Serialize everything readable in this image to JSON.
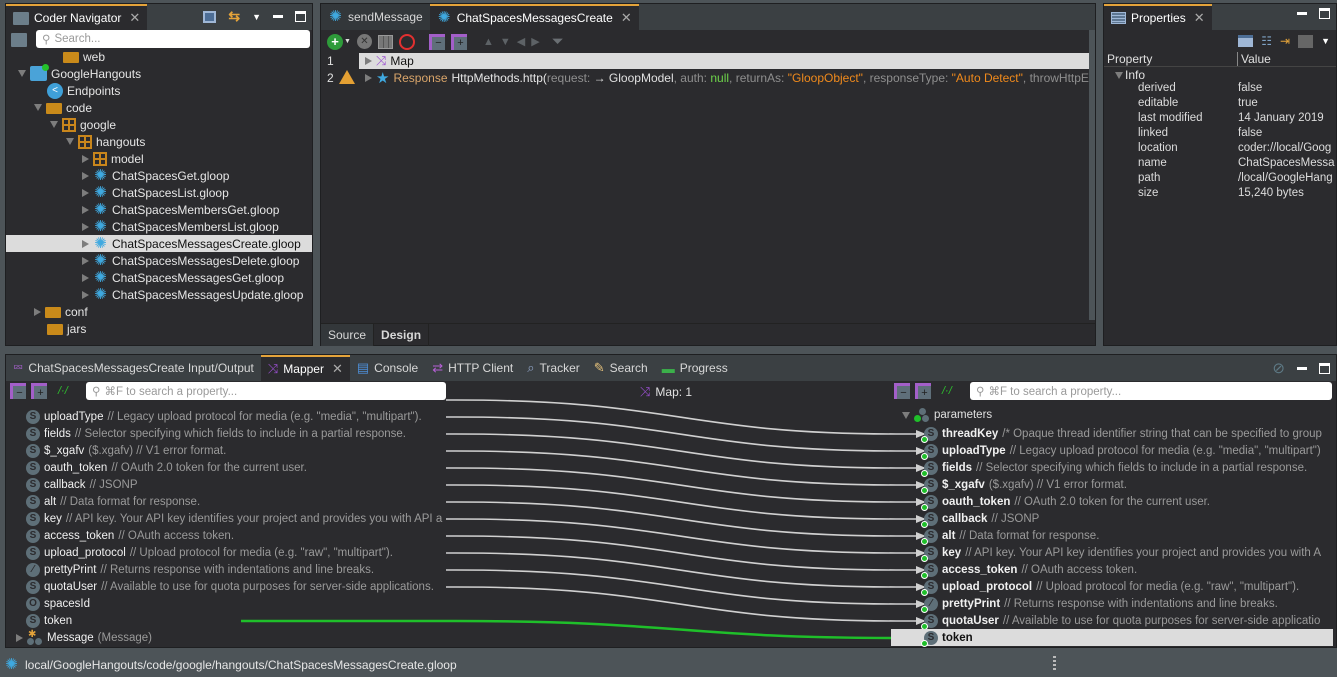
{
  "navigator": {
    "tab_label": "Coder Navigator",
    "search_placeholder": "Search...",
    "tree": [
      {
        "label": "web",
        "icon": "folder-icon",
        "expander": "none",
        "indent": 3
      },
      {
        "label": "GoogleHangouts",
        "icon": "package-cube-icon",
        "expander": "expanded",
        "indent": 1
      },
      {
        "label": "Endpoints",
        "icon": "share-icon",
        "expander": "none",
        "indent": 2
      },
      {
        "label": "code",
        "icon": "folder-icon",
        "expander": "expanded",
        "indent": 2
      },
      {
        "label": "google",
        "icon": "package-icon",
        "expander": "expanded",
        "indent": 3
      },
      {
        "label": "hangouts",
        "icon": "package-icon",
        "expander": "expanded",
        "indent": 4
      },
      {
        "label": "model",
        "icon": "package-icon",
        "expander": "collapsed",
        "indent": 5
      },
      {
        "label": "ChatSpacesGet.gloop",
        "icon": "gloop-icon",
        "expander": "collapsed",
        "indent": 5
      },
      {
        "label": "ChatSpacesList.gloop",
        "icon": "gloop-icon",
        "expander": "collapsed",
        "indent": 5
      },
      {
        "label": "ChatSpacesMembersGet.gloop",
        "icon": "gloop-icon",
        "expander": "collapsed",
        "indent": 5
      },
      {
        "label": "ChatSpacesMembersList.gloop",
        "icon": "gloop-icon",
        "expander": "collapsed",
        "indent": 5
      },
      {
        "label": "ChatSpacesMessagesCreate.gloop",
        "icon": "gloop-icon",
        "expander": "collapsed",
        "indent": 5,
        "selected": true
      },
      {
        "label": "ChatSpacesMessagesDelete.gloop",
        "icon": "gloop-icon",
        "expander": "collapsed",
        "indent": 5
      },
      {
        "label": "ChatSpacesMessagesGet.gloop",
        "icon": "gloop-icon",
        "expander": "collapsed",
        "indent": 5
      },
      {
        "label": "ChatSpacesMessagesUpdate.gloop",
        "icon": "gloop-icon",
        "expander": "collapsed",
        "indent": 5
      },
      {
        "label": "conf",
        "icon": "folder-icon",
        "expander": "collapsed",
        "indent": 2
      },
      {
        "label": "jars",
        "icon": "folder-icon",
        "expander": "none",
        "indent": 2
      }
    ]
  },
  "editor": {
    "tabs": [
      {
        "label": "sendMessage",
        "active": false
      },
      {
        "label": "ChatSpacesMessagesCreate",
        "active": true
      }
    ],
    "lines": [
      {
        "num": "1",
        "label": "Map"
      },
      {
        "num": "2",
        "prefix": "Response",
        "call": "HttpMethods.http(",
        "args": [
          {
            "k": " request: ",
            "v": "→ GloopModel",
            "c": "#e0e0e0"
          },
          {
            "k": ", auth: ",
            "v": "null",
            "c": "#6dd34a"
          },
          {
            "k": ", returnAs: ",
            "v": "\"GloopObject\"",
            "c": "#f08a1c"
          },
          {
            "k": ", responseType: ",
            "v": "\"Auto Detect\"",
            "c": "#f08a1c"
          },
          {
            "k": ", throwHttpExc",
            "v": "",
            "c": "#e0e0e0"
          }
        ]
      }
    ],
    "bottom_tabs": [
      "Source",
      "Design"
    ],
    "active_bottom_tab": "Design"
  },
  "properties": {
    "tab_label": "Properties",
    "col_property": "Property",
    "col_value": "Value",
    "group": "Info",
    "rows": [
      {
        "k": "derived",
        "v": "false"
      },
      {
        "k": "editable",
        "v": "true"
      },
      {
        "k": "last modified",
        "v": "14 January 2019"
      },
      {
        "k": "linked",
        "v": "false"
      },
      {
        "k": "location",
        "v": "coder://local/Goog"
      },
      {
        "k": "name",
        "v": "ChatSpacesMessa"
      },
      {
        "k": "path",
        "v": "/local/GoogleHang"
      },
      {
        "k": "size",
        "v": "15,240  bytes"
      }
    ]
  },
  "bottom": {
    "tabs": [
      {
        "label": "ChatSpacesMessagesCreate Input/Output",
        "icon": "input-output-icon"
      },
      {
        "label": "Mapper",
        "icon": "shuffle-icon",
        "active": true
      },
      {
        "label": "Console",
        "icon": "console-icon"
      },
      {
        "label": "HTTP Client",
        "icon": "http-arrows-icon"
      },
      {
        "label": "Tracker",
        "icon": "tracker-icon"
      },
      {
        "label": "Search",
        "icon": "search-flashlight-icon"
      },
      {
        "label": "Progress",
        "icon": "progress-icon"
      }
    ],
    "search_placeholder": "⌘F to search a property...",
    "map_label": "Map: 1",
    "left_fields": [
      {
        "name": "uploadType",
        "comment": "// Legacy upload protocol for media (e.g. \"media\", \"multipart\").",
        "type": "S"
      },
      {
        "name": "fields",
        "comment": "// Selector specifying which fields to include in a partial response.",
        "type": "S"
      },
      {
        "name": "$_xgafv",
        "comment": "($.xgafv) // V1 error format.",
        "type": "S"
      },
      {
        "name": "oauth_token",
        "comment": "// OAuth 2.0 token for the current user.",
        "type": "S"
      },
      {
        "name": "callback",
        "comment": "// JSONP",
        "type": "S"
      },
      {
        "name": "alt",
        "comment": "// Data format for response.",
        "type": "S"
      },
      {
        "name": "key",
        "comment": "// API key. Your API key identifies your project and provides you with API a",
        "type": "S"
      },
      {
        "name": "access_token",
        "comment": "// OAuth access token.",
        "type": "S"
      },
      {
        "name": "upload_protocol",
        "comment": "// Upload protocol for media (e.g. \"raw\", \"multipart\").",
        "type": "S"
      },
      {
        "name": "prettyPrint",
        "comment": "// Returns response with indentations and line breaks.",
        "type": "T/F"
      },
      {
        "name": "quotaUser",
        "comment": "// Available to use for quota purposes for server-side applications.",
        "type": "S"
      },
      {
        "name": "spacesId",
        "comment": "",
        "type": "O"
      },
      {
        "name": "token",
        "comment": "",
        "type": "S"
      }
    ],
    "left_message": {
      "name": "Message",
      "comment": "(Message)"
    },
    "right_group": "parameters",
    "right_fields": [
      {
        "name": "threadKey",
        "comment": "/* Opaque thread identifier string that can be specified to group",
        "type": "S"
      },
      {
        "name": "uploadType",
        "comment": "// Legacy upload protocol for media (e.g. \"media\", \"multipart\")",
        "type": "S"
      },
      {
        "name": "fields",
        "comment": "// Selector specifying which fields to include in a partial response.",
        "type": "S"
      },
      {
        "name": "$_xgafv",
        "comment": "($.xgafv) // V1 error format.",
        "type": "S"
      },
      {
        "name": "oauth_token",
        "comment": "// OAuth 2.0 token for the current user.",
        "type": "S"
      },
      {
        "name": "callback",
        "comment": "// JSONP",
        "type": "S"
      },
      {
        "name": "alt",
        "comment": "// Data format for response.",
        "type": "S"
      },
      {
        "name": "key",
        "comment": "// API key. Your API key identifies your project and provides you with A",
        "type": "S"
      },
      {
        "name": "access_token",
        "comment": "// OAuth access token.",
        "type": "S"
      },
      {
        "name": "upload_protocol",
        "comment": "// Upload protocol for media (e.g. \"raw\", \"multipart\").",
        "type": "S"
      },
      {
        "name": "prettyPrint",
        "comment": "// Returns response with indentations and line breaks.",
        "type": "T/F"
      },
      {
        "name": "quotaUser",
        "comment": "// Available to use for quota purposes for server-side applicatio",
        "type": "S"
      },
      {
        "name": "token",
        "comment": "",
        "type": "S",
        "selected": true
      }
    ],
    "colors": {
      "link_white": "#d0d0d0",
      "link_green": "#1fbf2a"
    }
  },
  "status": {
    "path": "local/GoogleHangouts/code/google/hangouts/ChatSpacesMessagesCreate.gloop"
  }
}
